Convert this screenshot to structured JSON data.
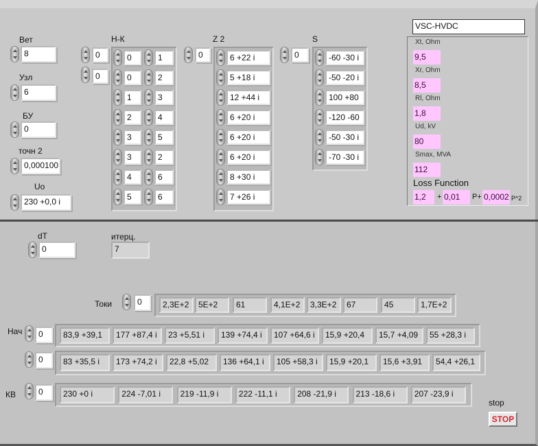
{
  "inputs": {
    "vet": {
      "label": "Вет",
      "value": "8"
    },
    "uzl": {
      "label": "Узл",
      "value": "6"
    },
    "bu": {
      "label": "БУ",
      "value": "0"
    },
    "tochn2": {
      "label": "точн 2",
      "value": "0,000100"
    },
    "uo": {
      "label": "Uo",
      "value": "230 +0,0 i"
    }
  },
  "hk": {
    "label": "Н-К",
    "index1": "0",
    "index2": "0",
    "rows": [
      [
        "0",
        "1"
      ],
      [
        "0",
        "2"
      ],
      [
        "1",
        "3"
      ],
      [
        "2",
        "4"
      ],
      [
        "3",
        "5"
      ],
      [
        "3",
        "2"
      ],
      [
        "4",
        "6"
      ],
      [
        "5",
        "6"
      ]
    ]
  },
  "z2": {
    "label": "Z 2",
    "index": "0",
    "values": [
      "6 +22 i",
      "5 +18 i",
      "12 +44 i",
      "6 +20 i",
      "6 +20 i",
      "6 +20 i",
      "8 +30 i",
      "7 +26 i"
    ]
  },
  "s": {
    "label": "S",
    "index": "0",
    "values": [
      "-60 -30 i",
      "-50 -20 i",
      "100 +80",
      "-120 -60",
      "-50 -30 i",
      "-70 -30 i"
    ]
  },
  "vsc": {
    "title": "VSC-HVDC",
    "params": [
      {
        "label": "Xt, Ohm",
        "value": "9,5"
      },
      {
        "label": "Xr, Ohm",
        "value": "8,5"
      },
      {
        "label": "Rl, Ohm",
        "value": "1,8"
      },
      {
        "label": "Ud, kV",
        "value": "80"
      },
      {
        "label": "Smax, MVA",
        "value": "112"
      }
    ],
    "loss": {
      "label": "Loss Function",
      "a": "1,2",
      "plus": "+",
      "b": "0,01",
      "p_plus": "P+",
      "c": "0,0002",
      "p2": "P^2"
    }
  },
  "dt": {
    "label": "dT",
    "value": "0"
  },
  "iter": {
    "label": "итерц.",
    "value": "7"
  },
  "toki": {
    "label": "Токи",
    "index": "0",
    "values": [
      "2,3E+2",
      "5E+2",
      "61",
      "4,1E+2",
      "3,3E+2",
      "67",
      "45",
      "1,7E+2"
    ]
  },
  "nach": {
    "label": "Нач",
    "index1": "0",
    "index2": "0",
    "row1": [
      "83,9 +39,1",
      "177 +87,4 i",
      "23 +5,51 i",
      "139 +74,4 i",
      "107 +64,6 i",
      "15,9 +20,4",
      "15,7 +4,09",
      "55 +28,3 i"
    ],
    "row2": [
      "83 +35,5 i",
      "173 +74,2 i",
      "22,8 +5,02",
      "136 +64,1 i",
      "105 +58,3 i",
      "15,9 +20,1",
      "15,6 +3,91",
      "54,4 +26,1"
    ]
  },
  "kv": {
    "label": "КВ",
    "index": "0",
    "values": [
      "230 +0 i",
      "224 -7,01 i",
      "219 -11,9 i",
      "222 -11,1 i",
      "208 -21,9 i",
      "213 -18,6 i",
      "207 -23,9 i"
    ]
  },
  "stop": {
    "label": "stop",
    "button": "STOP",
    "color": "#e0202a"
  },
  "colors": {
    "pink": "#ffc6ff",
    "panel": "#c9c9c9"
  }
}
